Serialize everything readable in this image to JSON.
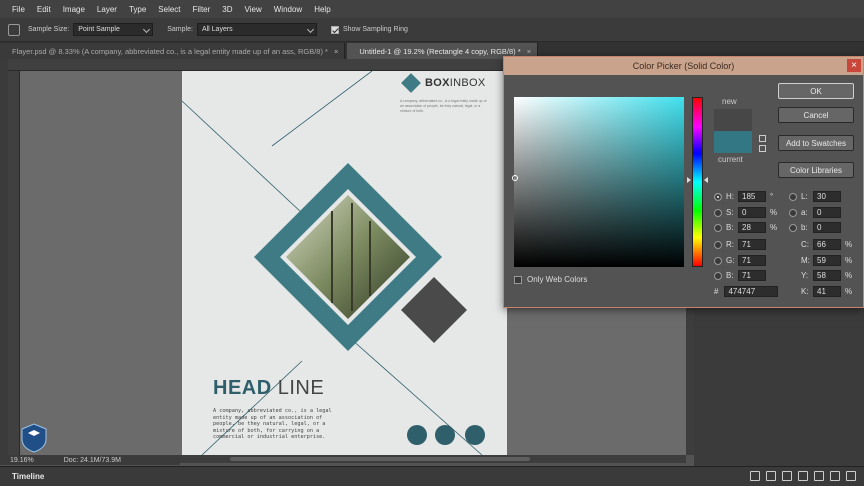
{
  "menu": [
    "File",
    "Edit",
    "Image",
    "Layer",
    "Type",
    "Select",
    "Filter",
    "3D",
    "View",
    "Window",
    "Help"
  ],
  "options": {
    "sample_size_label": "Sample Size:",
    "sample_size_value": "Point Sample",
    "sample_label": "Sample:",
    "sample_value": "All Layers",
    "show_ring_label": "Show Sampling Ring"
  },
  "tabs": [
    {
      "label": "Flayer.psd @ 8.33% (A company, abbreviated co., is a legal entity made up of an ass, RGB/8) *"
    },
    {
      "label": "Untitled-1 @ 19.2% (Rectangle 4 copy, RGB/8) *"
    }
  ],
  "status": {
    "zoom": "19.16%",
    "doc": "Doc: 24.1M/73.9M"
  },
  "timeline_label": "Timeline",
  "flyer": {
    "brand_bold": "BOX",
    "brand_rest": "INBOX",
    "brand_sub": "A company, abbreviated co., is a legal entity made up of an association of people, be they natural, legal, or a mixture of both.",
    "headline_bold": "HEAD",
    "headline_light": "LINE",
    "body": "A company, abbreviated co., is a legal entity made up of an association of people, be they natural, legal, or a mixture of both, for carrying on a commercial or industrial enterprise."
  },
  "picker": {
    "title": "Color Picker (Solid Color)",
    "close": "×",
    "ok": "OK",
    "cancel": "Cancel",
    "add_swatches": "Add to Swatches",
    "color_libraries": "Color Libraries",
    "new_label": "new",
    "current_label": "current",
    "only_web": "Only Web Colors",
    "new_color": "#474747",
    "current_color": "#337784",
    "fields": {
      "H": "185",
      "S": "0",
      "Bv": "28",
      "R": "71",
      "G": "71",
      "Bc": "71",
      "L": "30",
      "a": "0",
      "b": "0",
      "C": "66",
      "M": "59",
      "Y": "58",
      "K": "41"
    },
    "units": {
      "deg": "°",
      "pct": "%"
    },
    "hex_label": "#",
    "hex": "474747"
  }
}
